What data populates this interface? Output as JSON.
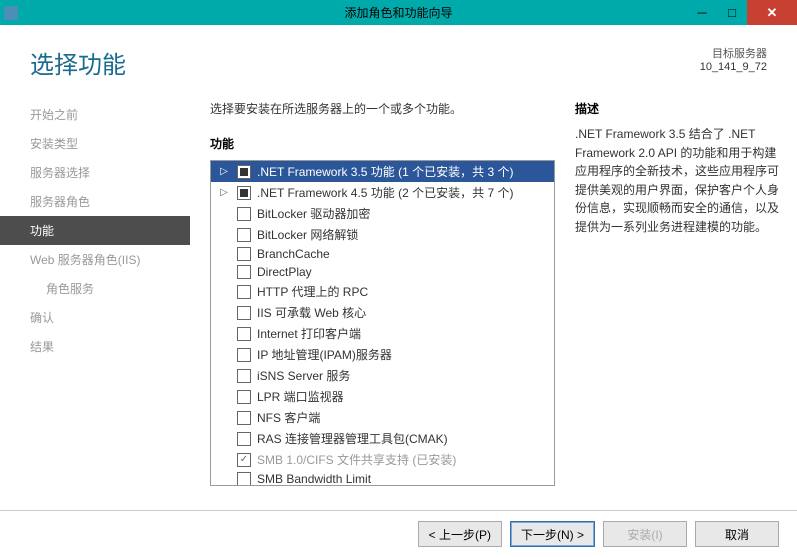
{
  "titlebar": {
    "title": "添加角色和功能向导"
  },
  "page": {
    "title": "选择功能",
    "target_label": "目标服务器",
    "target_value": "10_141_9_72"
  },
  "sidebar": {
    "items": [
      {
        "label": "开始之前",
        "active": false
      },
      {
        "label": "安装类型",
        "active": false
      },
      {
        "label": "服务器选择",
        "active": false
      },
      {
        "label": "服务器角色",
        "active": false
      },
      {
        "label": "功能",
        "active": true
      },
      {
        "label": "Web 服务器角色(IIS)",
        "active": false
      },
      {
        "label": "角色服务",
        "active": false,
        "sub": true
      },
      {
        "label": "确认",
        "active": false
      },
      {
        "label": "结果",
        "active": false
      }
    ]
  },
  "main": {
    "instruction": "选择要安装在所选服务器上的一个或多个功能。",
    "features_label": "功能",
    "desc_label": "描述",
    "desc_text": ".NET Framework 3.5 结合了 .NET Framework 2.0 API 的功能和用于构建应用程序的全新技术，这些应用程序可提供美观的用户界面，保护客户个人身份信息，实现顺畅而安全的通信，以及提供为一系列业务进程建模的功能。",
    "features": [
      {
        "label": ".NET Framework 3.5 功能 (1 个已安装，共 3 个)",
        "state": "partial",
        "expander": true,
        "selected": true
      },
      {
        "label": ".NET Framework 4.5 功能 (2 个已安装，共 7 个)",
        "state": "partial",
        "expander": true
      },
      {
        "label": "BitLocker 驱动器加密",
        "state": "unchecked"
      },
      {
        "label": "BitLocker 网络解锁",
        "state": "unchecked"
      },
      {
        "label": "BranchCache",
        "state": "unchecked"
      },
      {
        "label": "DirectPlay",
        "state": "unchecked"
      },
      {
        "label": "HTTP 代理上的 RPC",
        "state": "unchecked"
      },
      {
        "label": "IIS 可承载 Web 核心",
        "state": "unchecked"
      },
      {
        "label": "Internet 打印客户端",
        "state": "unchecked"
      },
      {
        "label": "IP 地址管理(IPAM)服务器",
        "state": "unchecked"
      },
      {
        "label": "iSNS Server 服务",
        "state": "unchecked"
      },
      {
        "label": "LPR 端口监视器",
        "state": "unchecked"
      },
      {
        "label": "NFS 客户端",
        "state": "unchecked"
      },
      {
        "label": "RAS 连接管理器管理工具包(CMAK)",
        "state": "unchecked"
      },
      {
        "label": "SMB 1.0/CIFS 文件共享支持 (已安装)",
        "state": "checked",
        "disabled": true
      },
      {
        "label": "SMB Bandwidth Limit",
        "state": "unchecked"
      }
    ]
  },
  "buttons": {
    "prev": "< 上一步(P)",
    "next": "下一步(N) >",
    "install": "安装(I)",
    "cancel": "取消"
  }
}
